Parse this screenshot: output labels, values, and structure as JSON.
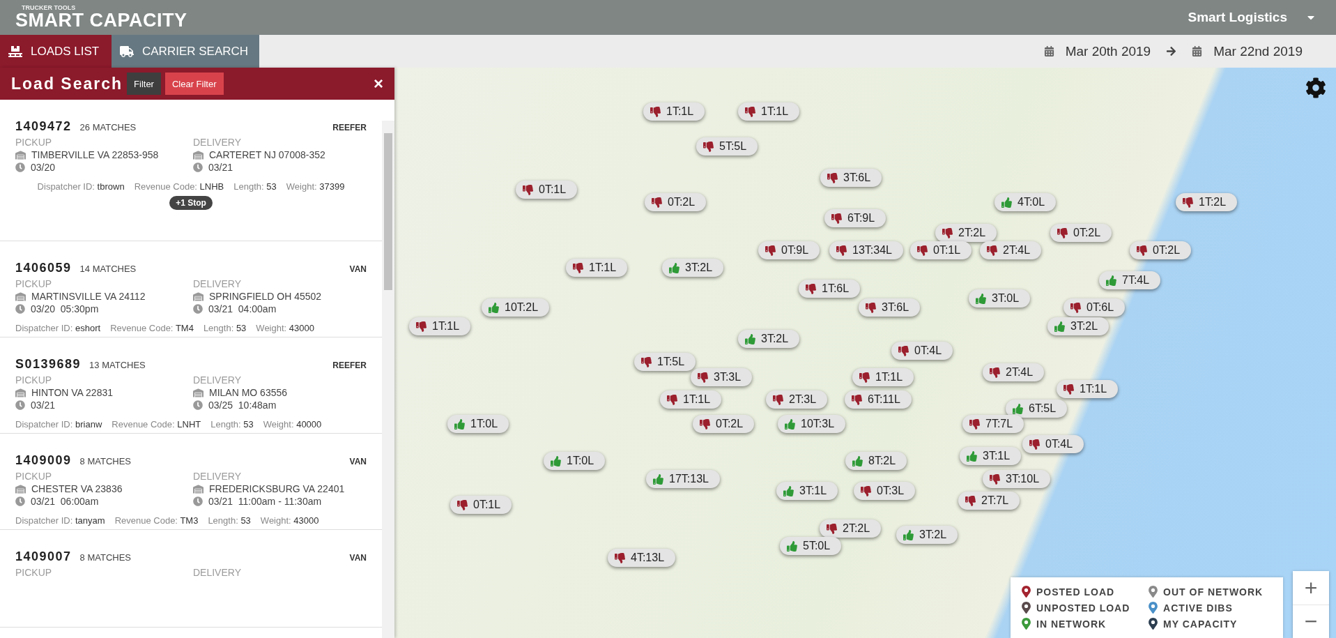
{
  "header": {
    "brand_small": "TRUCKER TOOLS",
    "brand": "SMART CAPACITY",
    "account": "Smart Logistics"
  },
  "tabs": [
    {
      "label": "LOADS LIST",
      "selected": true
    },
    {
      "label": "CARRIER SEARCH",
      "selected": false
    }
  ],
  "date_range": {
    "start": "Mar 20th 2019",
    "end": "Mar 22nd 2019"
  },
  "panel": {
    "title": "Load Search",
    "buttons": [
      {
        "label": "Filter",
        "kind": "dark"
      },
      {
        "label": "Clear Filter",
        "kind": "danger"
      }
    ],
    "close": "×"
  },
  "loads": [
    {
      "id": "1409472",
      "matches": "26 MATCHES",
      "equipment": "REEFER",
      "pickup": {
        "label": "PICKUP",
        "place": "TIMBERVILLE VA 22853-958",
        "time": "03/20"
      },
      "delivery": {
        "label": "DELIVERY",
        "place": "CARTERET NJ 07008-352",
        "time": "03/21"
      },
      "details": [
        {
          "label": "Dispatcher ID:",
          "value": "tbrown"
        },
        {
          "label": "Revenue Code:",
          "value": "LNHB"
        },
        {
          "label": "Length:",
          "value": "53"
        },
        {
          "label": "Weight:",
          "value": "37399"
        }
      ],
      "stops": "+1 Stop"
    },
    {
      "id": "1406059",
      "matches": "14 MATCHES",
      "equipment": "VAN",
      "pickup": {
        "label": "PICKUP",
        "place": "MARTINSVILLE VA 24112",
        "time": "03/20  05:30pm"
      },
      "delivery": {
        "label": "DELIVERY",
        "place": "SPRINGFIELD OH 45502",
        "time": "03/21  04:00am"
      },
      "details": [
        {
          "label": "Dispatcher ID:",
          "value": "eshort"
        },
        {
          "label": "Revenue Code:",
          "value": "TM4"
        },
        {
          "label": "Length:",
          "value": "53"
        },
        {
          "label": "Weight:",
          "value": "43000"
        }
      ]
    },
    {
      "id": "S0139689",
      "matches": "13 MATCHES",
      "equipment": "REEFER",
      "pickup": {
        "label": "PICKUP",
        "place": "HINTON VA 22831",
        "time": "03/21"
      },
      "delivery": {
        "label": "DELIVERY",
        "place": "MILAN MO 63556",
        "time": "03/25  10:48am"
      },
      "details": [
        {
          "label": "Dispatcher ID:",
          "value": "brianw"
        },
        {
          "label": "Revenue Code:",
          "value": "LNHT"
        },
        {
          "label": "Length:",
          "value": "53"
        },
        {
          "label": "Weight:",
          "value": "40000"
        }
      ]
    },
    {
      "id": "1409009",
      "matches": "8 MATCHES",
      "equipment": "VAN",
      "pickup": {
        "label": "PICKUP",
        "place": "CHESTER VA 23836",
        "time": "03/21  06:00am"
      },
      "delivery": {
        "label": "DELIVERY",
        "place": "FREDERICKSBURG VA 22401",
        "time": "03/21  11:00am - 11:30am"
      },
      "details": [
        {
          "label": "Dispatcher ID:",
          "value": "tanyam"
        },
        {
          "label": "Revenue Code:",
          "value": "TM3"
        },
        {
          "label": "Length:",
          "value": "53"
        },
        {
          "label": "Weight:",
          "value": "43000"
        }
      ]
    },
    {
      "id": "1409007",
      "matches": "8 MATCHES",
      "equipment": "VAN",
      "pickup": {
        "label": "PICKUP"
      },
      "delivery": {
        "label": "DELIVERY"
      }
    }
  ],
  "markers": [
    {
      "label": "1T:1L",
      "kind": "down"
    },
    {
      "label": "1T:1L",
      "kind": "down"
    },
    {
      "label": "5T:5L",
      "kind": "down"
    },
    {
      "label": "3T:6L",
      "kind": "down"
    },
    {
      "label": "0T:1L",
      "kind": "down"
    },
    {
      "label": "0T:2L",
      "kind": "down"
    },
    {
      "label": "4T:0L",
      "kind": "up"
    },
    {
      "label": "1T:2L",
      "kind": "down"
    },
    {
      "label": "6T:9L",
      "kind": "down"
    },
    {
      "label": "2T:2L",
      "kind": "down"
    },
    {
      "label": "0T:2L",
      "kind": "down"
    },
    {
      "label": "0T:9L",
      "kind": "down"
    },
    {
      "label": "13T:34L",
      "kind": "down"
    },
    {
      "label": "0T:1L",
      "kind": "down"
    },
    {
      "label": "2T:4L",
      "kind": "down"
    },
    {
      "label": "0T:2L",
      "kind": "down"
    },
    {
      "label": "1T:1L",
      "kind": "down"
    },
    {
      "label": "3T:2L",
      "kind": "up"
    },
    {
      "label": "7T:4L",
      "kind": "up"
    },
    {
      "label": "1T:6L",
      "kind": "down"
    },
    {
      "label": "3T:0L",
      "kind": "up"
    },
    {
      "label": "10T:2L",
      "kind": "up"
    },
    {
      "label": "3T:6L",
      "kind": "down"
    },
    {
      "label": "0T:6L",
      "kind": "down"
    },
    {
      "label": "1T:1L",
      "kind": "down"
    },
    {
      "label": "3T:2L",
      "kind": "up"
    },
    {
      "label": "3T:2L",
      "kind": "up"
    },
    {
      "label": "0T:4L",
      "kind": "down"
    },
    {
      "label": "1T:5L",
      "kind": "down"
    },
    {
      "label": "2T:4L",
      "kind": "down"
    },
    {
      "label": "3T:3L",
      "kind": "down"
    },
    {
      "label": "1T:1L",
      "kind": "down"
    },
    {
      "label": "1T:1L",
      "kind": "down"
    },
    {
      "label": "1T:1L",
      "kind": "down"
    },
    {
      "label": "2T:3L",
      "kind": "down"
    },
    {
      "label": "6T:11L",
      "kind": "down"
    },
    {
      "label": "6T:5L",
      "kind": "up"
    },
    {
      "label": "1T:0L",
      "kind": "up"
    },
    {
      "label": "0T:2L",
      "kind": "down"
    },
    {
      "label": "10T:3L",
      "kind": "up"
    },
    {
      "label": "7T:7L",
      "kind": "down"
    },
    {
      "label": "0T:4L",
      "kind": "down"
    },
    {
      "label": "3T:1L",
      "kind": "up"
    },
    {
      "label": "1T:0L",
      "kind": "up"
    },
    {
      "label": "8T:2L",
      "kind": "up"
    },
    {
      "label": "17T:13L",
      "kind": "up"
    },
    {
      "label": "3T:10L",
      "kind": "down"
    },
    {
      "label": "3T:1L",
      "kind": "up"
    },
    {
      "label": "0T:3L",
      "kind": "down"
    },
    {
      "label": "2T:7L",
      "kind": "down"
    },
    {
      "label": "0T:1L",
      "kind": "down"
    },
    {
      "label": "2T:2L",
      "kind": "down"
    },
    {
      "label": "3T:2L",
      "kind": "up"
    },
    {
      "label": "5T:0L",
      "kind": "up"
    },
    {
      "label": "4T:13L",
      "kind": "down"
    }
  ],
  "legend": [
    {
      "label": "POSTED LOAD",
      "color": "#a3242f"
    },
    {
      "label": "OUT OF NETWORK",
      "color": "#8a8a8a"
    },
    {
      "label": "UNPOSTED LOAD",
      "color": "#5a4a4c"
    },
    {
      "label": "ACTIVE DIBS",
      "color": "#4a90c8"
    },
    {
      "label": "IN NETWORK",
      "color": "#3c9a3c"
    },
    {
      "label": "MY CAPACITY",
      "color": "#2c3e50"
    }
  ],
  "zoom_controls": [
    "+",
    "−"
  ]
}
